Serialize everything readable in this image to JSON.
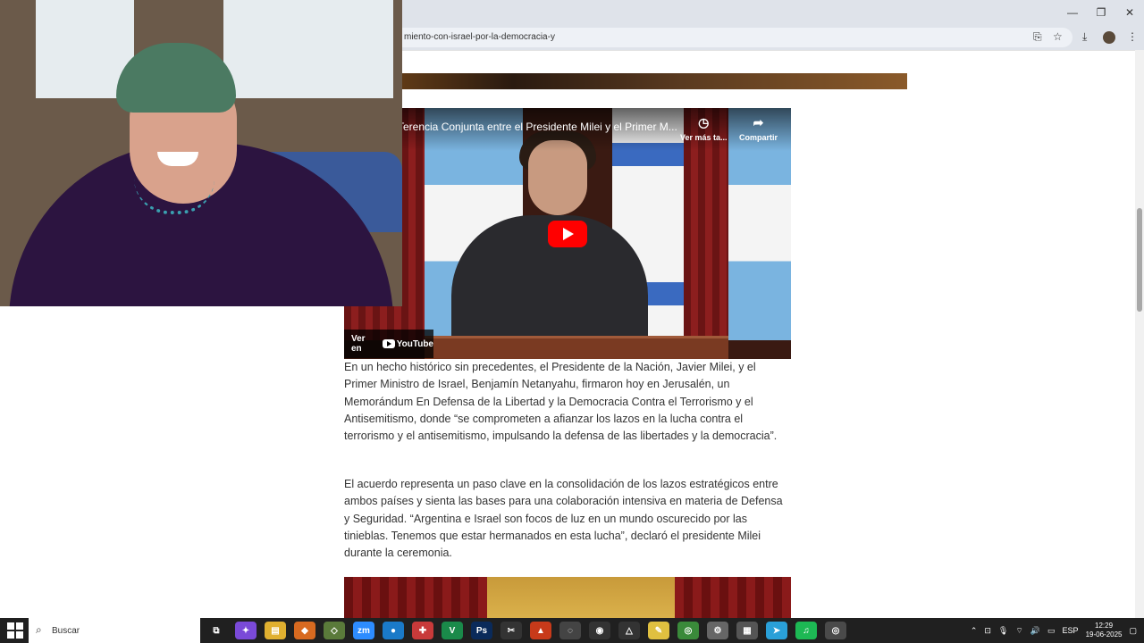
{
  "browser": {
    "url": "miento-con-israel-por-la-democracia-y",
    "window_controls": [
      "—",
      "❐",
      "✕"
    ]
  },
  "video": {
    "title": "Terencia Conjunta entre el Presidente Milei y el Primer M...",
    "watch_later_label": "Ver más ta...",
    "share_label": "Compartir",
    "ver_en_label": "Ver en",
    "youtube_label": "YouTube"
  },
  "article": {
    "paragraphs": [
      "En un hecho histórico sin precedentes, el Presidente de la Nación, Javier Milei, y el Primer Ministro de Israel, Benjamín Netanyahu, firmaron hoy en Jerusalén, un Memorándum En Defensa de la Libertad y la Democracia Contra el Terrorismo y el Antisemitismo, donde “se comprometen a afianzar los lazos en la lucha contra el terrorismo y el antisemitismo, impulsando la defensa de las libertades y la democracia”.",
      "El acuerdo representa un paso clave en la consolidación de los lazos estratégicos entre ambos países y sienta las bases para una colaboración intensiva en materia de Defensa y Seguridad. “Argentina e Israel son focos de luz en un mundo oscurecido por las tinieblas. Tenemos que estar hermanados en esta lucha”, declaró el presidente Milei durante la ceremonia."
    ]
  },
  "taskbar": {
    "search_label": "Buscar",
    "language": "ESP",
    "time": "12:29",
    "date": "19-06-2025",
    "apps": [
      {
        "name": "task-view",
        "label": "⧉",
        "color": "#202020"
      },
      {
        "name": "copilot",
        "label": "✦",
        "color": "#7a4ad8"
      },
      {
        "name": "file-explorer",
        "label": "▤",
        "color": "#e0b030"
      },
      {
        "name": "app-diamond",
        "label": "◆",
        "color": "#d86a20"
      },
      {
        "name": "app-cube",
        "label": "◇",
        "color": "#5a7a3a"
      },
      {
        "name": "zoom",
        "label": "zm",
        "color": "#2d8cff"
      },
      {
        "name": "app-sphere",
        "label": "●",
        "color": "#1a7ac8"
      },
      {
        "name": "app-red",
        "label": "✚",
        "color": "#c83a3a"
      },
      {
        "name": "vegas",
        "label": "V",
        "color": "#1a8a4a"
      },
      {
        "name": "photoshop",
        "label": "Ps",
        "color": "#0a2a5a"
      },
      {
        "name": "capcut",
        "label": "✂",
        "color": "#333333"
      },
      {
        "name": "app-triangle",
        "label": "▲",
        "color": "#c83a1a"
      },
      {
        "name": "app-circle",
        "label": "◌",
        "color": "#444444"
      },
      {
        "name": "obs",
        "label": "◉",
        "color": "#333333"
      },
      {
        "name": "app-delta",
        "label": "△",
        "color": "#333333"
      },
      {
        "name": "notes",
        "label": "✎",
        "color": "#e0c040"
      },
      {
        "name": "chrome",
        "label": "◎",
        "color": "#3a8a3a"
      },
      {
        "name": "app-gear",
        "label": "⚙",
        "color": "#666666"
      },
      {
        "name": "app-grid",
        "label": "▦",
        "color": "#555555"
      },
      {
        "name": "telegram",
        "label": "➤",
        "color": "#2aa0d8"
      },
      {
        "name": "spotify",
        "label": "♫",
        "color": "#1db954"
      },
      {
        "name": "chrome-active",
        "label": "◎",
        "color": "#4a4a4a"
      }
    ]
  }
}
